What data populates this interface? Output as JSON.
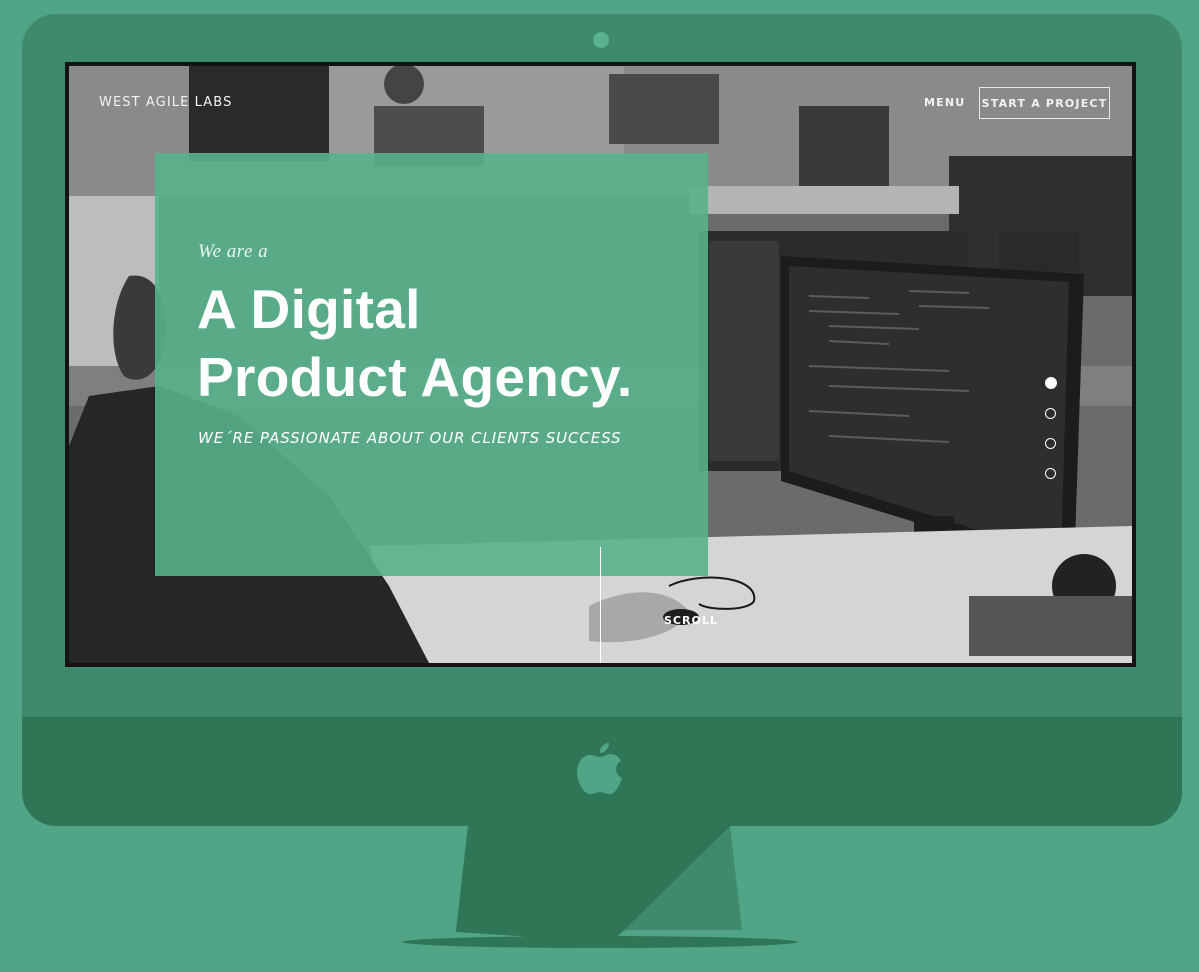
{
  "site": {
    "brand": "WEST AGILE LABS",
    "nav": {
      "menu_label": "MENU",
      "cta_label": "START A PROJECT"
    }
  },
  "hero": {
    "eyebrow": "We are a",
    "headline_line1": "A Digital",
    "headline_line2": "Product Agency.",
    "tagline": "WE´RE PASSIONATE ABOUT OUR CLIENTS SUCCESS",
    "scroll_label": "SCROLL"
  },
  "slider": {
    "slide_count": 4,
    "active_index": 0
  },
  "colors": {
    "background": "#4fa586",
    "monitor_bezel": "#3f8a6c",
    "monitor_chin": "#2f7656",
    "hero_card": "#58b28c"
  }
}
